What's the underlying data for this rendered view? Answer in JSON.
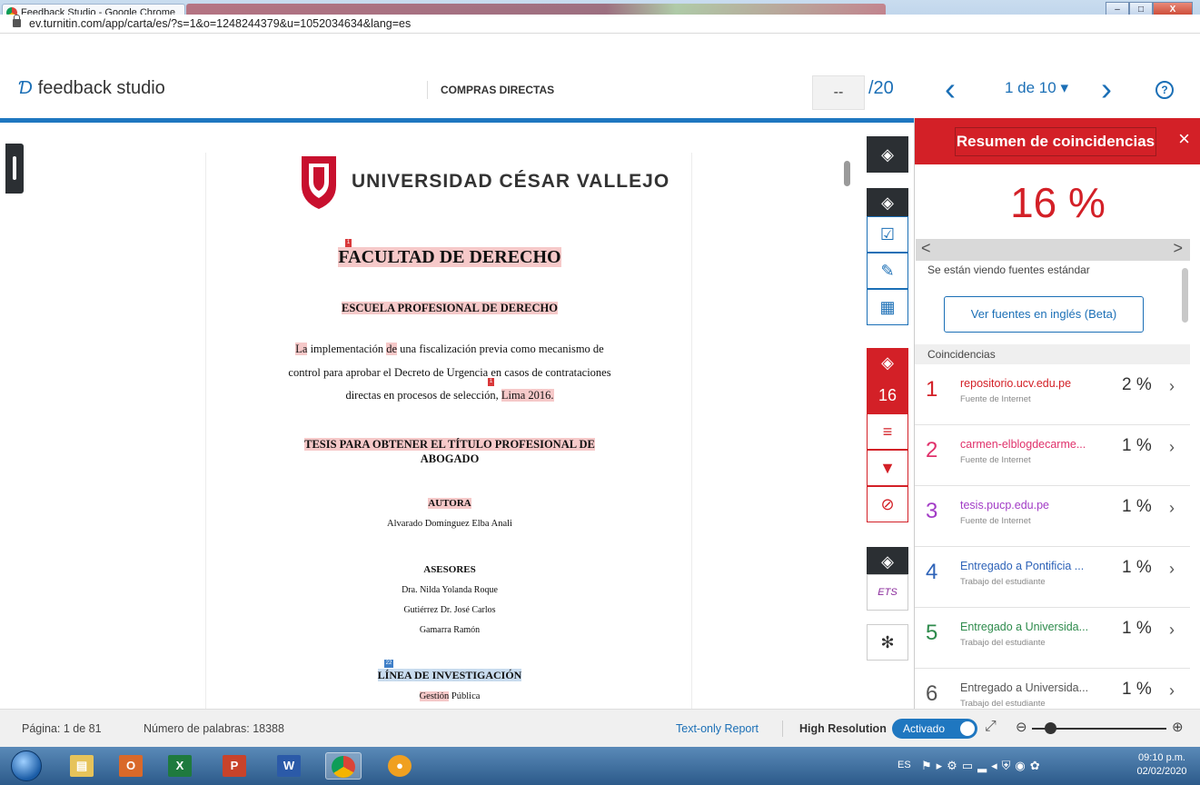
{
  "browser": {
    "tab_title": "Feedback Studio - Google Chrome",
    "url": "ev.turnitin.com/app/carta/es/?s=1&o=1248244379&u=1052034634&lang=es",
    "window_buttons": {
      "minimize": "–",
      "maximize": "□",
      "close": "X"
    }
  },
  "header": {
    "brand": "feedback studio",
    "doc_title": "COMPRAS DIRECTAS",
    "score": "--",
    "score_total": "/20",
    "prev": "‹",
    "page_selector": "1 de 10 ▾",
    "next": "›",
    "help": "?"
  },
  "document": {
    "university": "UNIVERSIDAD CÉSAR VALLEJO",
    "marker_1": "1",
    "faculty": "FACULTAD DE DERECHO",
    "school": "ESCUELA  PROFESIONAL DE DERECHO",
    "title_l1_a": "La",
    "title_l1_b": " implementación ",
    "title_l1_c": "de",
    "title_l1_d": " una fiscalización previa como mecanismo de",
    "title_l2": "control para aprobar el Decreto de Urgencia en casos de contrataciones",
    "title_l3_a": "directas en procesos de selección, ",
    "title_l3_b": "Lima 2016.",
    "thesis_l1": "TESIS PARA OBTENER EL TÍTULO PROFESIONAL DE",
    "thesis_l2": "ABOGADO",
    "author_label": "AUTORA",
    "author_name": "Alvarado Domínguez Elba Anali",
    "advisors_label": "ASESORES",
    "advisor_1": "Dra. Nilda Yolanda Roque",
    "advisor_2": "Gutiérrez Dr. José Carlos",
    "advisor_3": "Gamarra Ramón",
    "marker_22": "22",
    "research_line": "LÍNEA DE INVESTIGACIÓN",
    "research_value_a": "Gestión",
    "research_value_b": " Pública"
  },
  "tools": {
    "similarity_score": "16",
    "ets_label": "ETS"
  },
  "panel": {
    "title": "Resumen de coincidencias",
    "close": "×",
    "percent": "16 %",
    "pager_prev": "<",
    "pager_next": ">",
    "viewing": "Se están viendo fuentes estándar",
    "english_button": "Ver fuentes en inglés (Beta)",
    "matches_label": "Coincidencias",
    "matches": [
      {
        "num": "1",
        "source": "repositorio.ucv.edu.pe",
        "type": "Fuente de Internet",
        "percent": "2 %",
        "color": "#d32027"
      },
      {
        "num": "2",
        "source": "carmen-elblogdecarme...",
        "type": "Fuente de Internet",
        "percent": "1 %",
        "color": "#e0316b"
      },
      {
        "num": "3",
        "source": "tesis.pucp.edu.pe",
        "type": "Fuente de Internet",
        "percent": "1 %",
        "color": "#a23cc6"
      },
      {
        "num": "4",
        "source": "Entregado a Pontificia ...",
        "type": "Trabajo del estudiante",
        "percent": "1 %",
        "color": "#2e63b8"
      },
      {
        "num": "5",
        "source": "Entregado a Universida...",
        "type": "Trabajo del estudiante",
        "percent": "1 %",
        "color": "#2e8b4c"
      },
      {
        "num": "6",
        "source": "Entregado a Universida...",
        "type": "Trabajo del estudiante",
        "percent": "1 %",
        "color": "#555555"
      }
    ]
  },
  "status": {
    "page": "Página: 1 de 81",
    "words": "Número de palabras: 18388",
    "text_only": "Text-only Report",
    "high_res": "High Resolution",
    "toggle": "Activado"
  },
  "taskbar": {
    "lang": "ES",
    "time": "09:10 p.m.",
    "date": "02/02/2020"
  },
  "colors": {
    "turnitin_blue": "#1f77c0",
    "turnitin_red": "#d32027"
  }
}
